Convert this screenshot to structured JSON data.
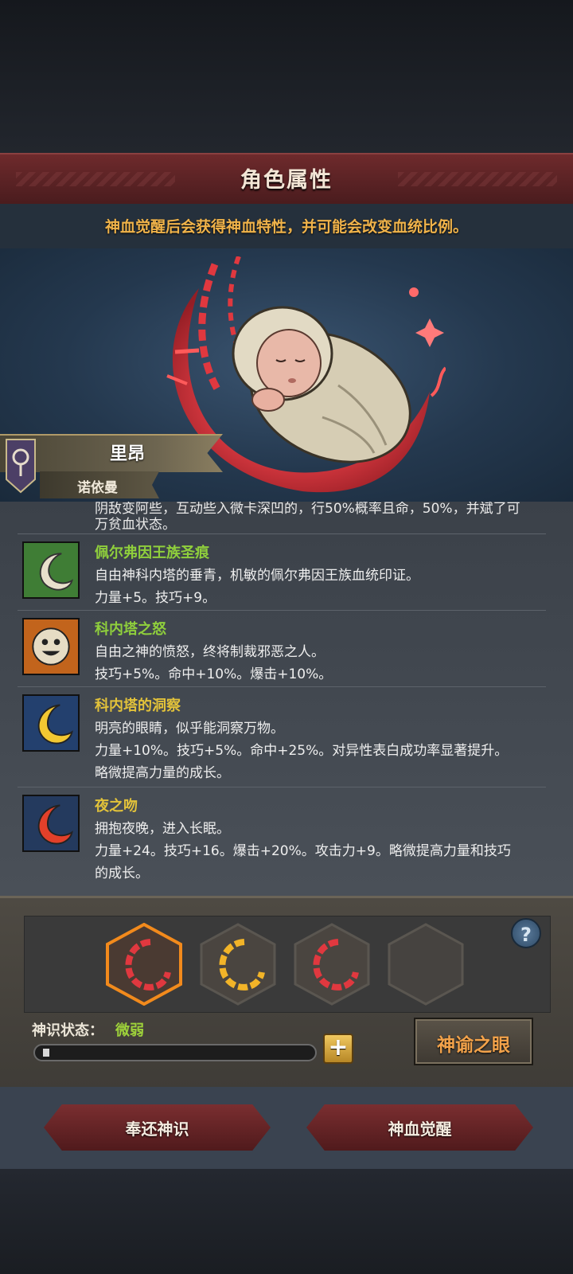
{
  "header": {
    "title": "角色属性",
    "hint": "神血觉醒后会获得神血特性，并可能会改变血统比例。"
  },
  "character": {
    "name": "里昂",
    "lineage": "诺依曼"
  },
  "traits": {
    "cut_off_line": "阴敌变阿些，互动些入微卡深凹的，行50%概率且命，50%，并斌了可",
    "cut_off_tail": "万贫血状态。",
    "items": [
      {
        "name": "佩尔弗因王族圣痕",
        "name_color": "#8fcf3c",
        "desc": "自由神科内塔的垂青，机敏的佩尔弗因王族血统印证。",
        "stats": "力量+5。技巧+9。",
        "stats2": ""
      },
      {
        "name": "科内塔之怒",
        "name_color": "#8fcf3c",
        "desc": "自由之神的愤怒，终将制裁邪恶之人。",
        "stats": "技巧+5%。命中+10%。爆击+10%。",
        "stats2": ""
      },
      {
        "name": "科内塔的洞察",
        "name_color": "#e2c23a",
        "desc": "明亮的眼睛，似乎能洞察万物。",
        "stats": "力量+10%。技巧+5%。命中+25%。对异性表白成功率显著提升。",
        "stats2": "略微提高力量的成长。"
      },
      {
        "name": "夜之吻",
        "name_color": "#e2c23a",
        "desc": "拥抱夜晚，进入长眠。",
        "stats": "力量+24。技巧+16。爆击+20%。攻击力+9。略微提高力量和技巧",
        "stats2": "的成长。"
      }
    ]
  },
  "bloodline": {
    "status_label": "神识状态：",
    "status_value": "微弱",
    "progress": 0.02,
    "help_symbol": "?",
    "plus_symbol": "+",
    "oracle_button": "神谕之眼"
  },
  "actions": {
    "return_button": "奉还神识",
    "awaken_button": "神血觉醒"
  },
  "colors": {
    "crimson": "#e0383f",
    "gold": "#f0b34a",
    "green": "#8fcf3c"
  }
}
